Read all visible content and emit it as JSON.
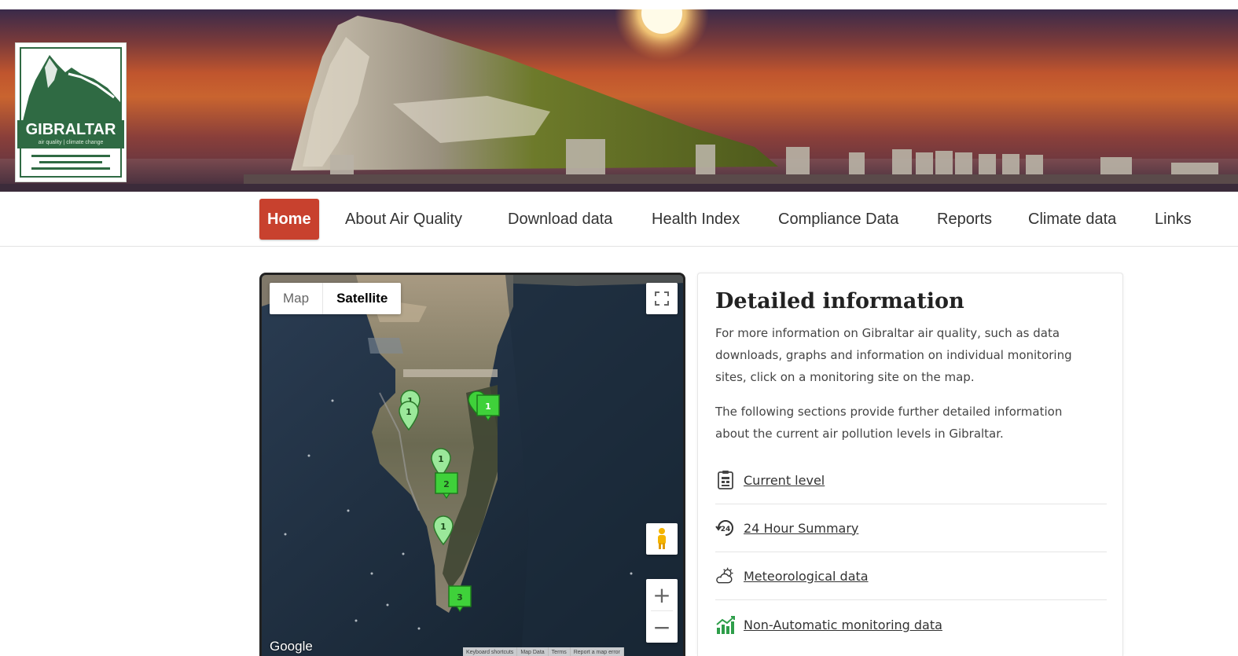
{
  "header": {
    "logo": {
      "title": "GIBRALTAR",
      "subtitle": "air quality | climate change"
    }
  },
  "nav": {
    "items": [
      {
        "label": "Home",
        "active": true
      },
      {
        "label": "About Air Quality"
      },
      {
        "label": "Download data"
      },
      {
        "label": "Health Index"
      },
      {
        "label": "Compliance Data"
      },
      {
        "label": "Reports"
      },
      {
        "label": "Climate data"
      },
      {
        "label": "Links"
      }
    ],
    "active_color": "#c8412e"
  },
  "map": {
    "type_tabs": {
      "map": "Map",
      "satellite": "Satellite"
    },
    "selected_type": "Satellite",
    "attribution": "Google",
    "footer": [
      "Keyboard shortcuts",
      "Map Data",
      "Terms",
      "Report a map error"
    ],
    "markers": [
      {
        "kind": "pin",
        "label": "1"
      },
      {
        "kind": "pin",
        "label": "1"
      },
      {
        "kind": "pin",
        "label": "1"
      },
      {
        "kind": "pin",
        "label": "1"
      },
      {
        "kind": "cluster",
        "label": "1"
      },
      {
        "kind": "cluster",
        "label": "2"
      },
      {
        "kind": "cluster",
        "label": "3"
      }
    ],
    "marker_color": "#3fd13a"
  },
  "panel": {
    "title": "Detailed information",
    "para1": "For more information on Gibraltar air quality, such as data downloads, graphs and information on individual monitoring sites, click on a monitoring site on the map.",
    "para2": "The following sections provide further detailed information about the current air pollution levels in Gibraltar.",
    "links": [
      {
        "label": "Current level",
        "icon": "clipboard-icon"
      },
      {
        "label": "24 Hour Summary",
        "icon": "24-hour-icon"
      },
      {
        "label": "Meteorological data",
        "icon": "weather-icon"
      },
      {
        "label": "Non-Automatic monitoring data",
        "icon": "bar-chart-icon"
      }
    ]
  }
}
